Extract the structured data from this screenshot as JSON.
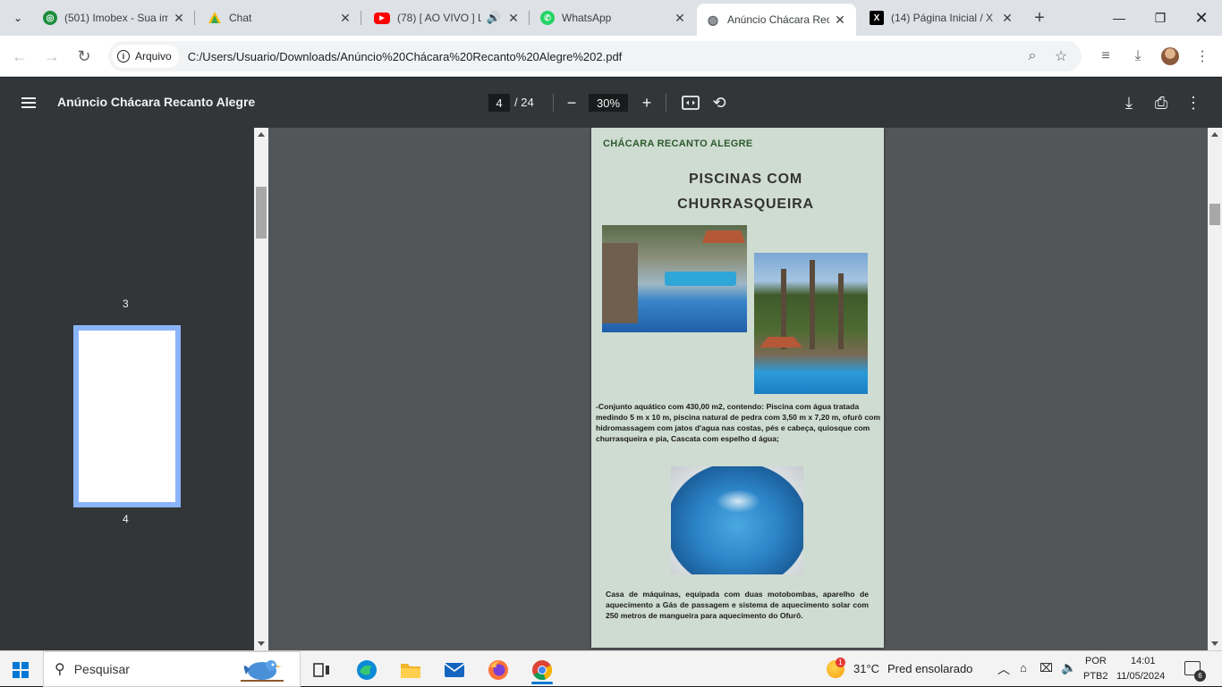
{
  "tabs": [
    {
      "title": "(501) Imobex - Sua imob",
      "icon": "imobex-icon",
      "color": "#1e8e3e"
    },
    {
      "title": "Chat",
      "icon": "chat-icon",
      "color": "#34a853"
    },
    {
      "title": "(78) [ AO VIVO ] L",
      "icon": "youtube-icon",
      "color": "#ff0000"
    },
    {
      "title": "WhatsApp",
      "icon": "whatsapp-icon",
      "color": "#25d366"
    },
    {
      "title": "Anúncio Chácara Rec",
      "icon": "globe-icon",
      "color": "#5f6368"
    },
    {
      "title": "(14) Página Inicial / X",
      "icon": "x-icon",
      "color": "#000000"
    }
  ],
  "address": {
    "chip_label": "Arquivo",
    "url": "C:/Users/Usuario/Downloads/Anúncio%20Chácara%20Recanto%20Alegre%202.pdf"
  },
  "pdf": {
    "title": "Anúncio Chácara Recanto Alegre",
    "current_page": "4",
    "total_pages": "/ 24",
    "zoom": "30%"
  },
  "sidebar": {
    "thumb_label_prev": "3",
    "thumb_label_current": "4"
  },
  "page_content": {
    "header": "CHÁCARA RECANTO ALEGRE",
    "title_line1": "PISCINAS COM",
    "title_line2": "CHURRASQUEIRA",
    "text1": "-Conjunto aquático com 430,00 m2, contendo: Piscina com água tratada medindo  5 m x 10 m, piscina natural de pedra com 3,50 m x 7,20 m, ofurô com hidromassagem com jatos d'agua nas costas, pés e cabeça, quiosque com churrasqueira e pia, Cascata com espelho d água;",
    "text2": "Casa de máquinas, equipada com duas motobombas, aparelho de aquecimento a Gás de passagem e sistema de aquecimento solar com 250 metros de mangueira  para aquecimento do Ofurô."
  },
  "taskbar": {
    "search_label": "Pesquisar",
    "weather_temp": "31°C",
    "weather_desc": "Pred ensolarado",
    "weather_badge": "1",
    "lang_top": "POR",
    "lang_bottom": "PTB2",
    "time": "14:01",
    "date": "11/05/2024",
    "notif_count": "6"
  },
  "colors": {
    "accent": "#0078d4",
    "pdf_toolbar": "#323639",
    "pdf_background": "#525659",
    "page_background": "#cfdcd2",
    "thumb_highlight": "#8ab4f8"
  }
}
